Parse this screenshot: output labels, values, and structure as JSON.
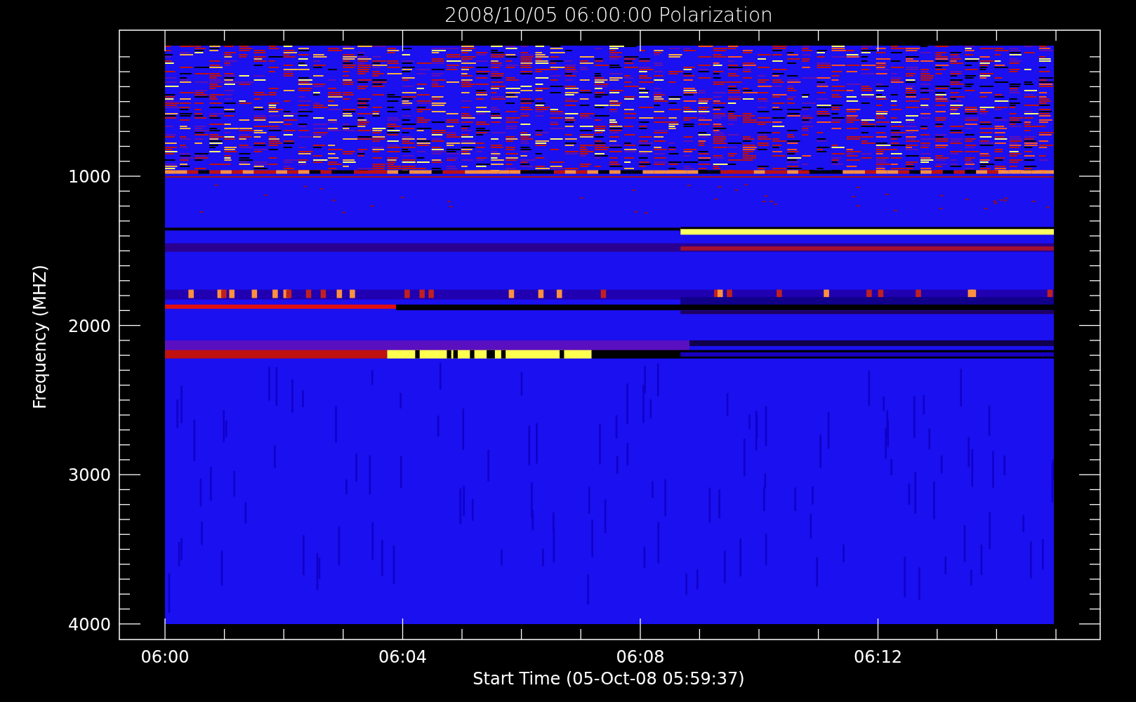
{
  "title": "2008/10/05 06:00:00 Polarization",
  "y_axis": {
    "label": "Frequency (MHZ)",
    "ticks": [
      "1000",
      "2000",
      "3000",
      "4000"
    ]
  },
  "x_axis": {
    "label": "Start Time (05-Oct-08 05:59:37)",
    "ticks": [
      "06:00",
      "06:04",
      "06:08",
      "06:12"
    ]
  }
}
